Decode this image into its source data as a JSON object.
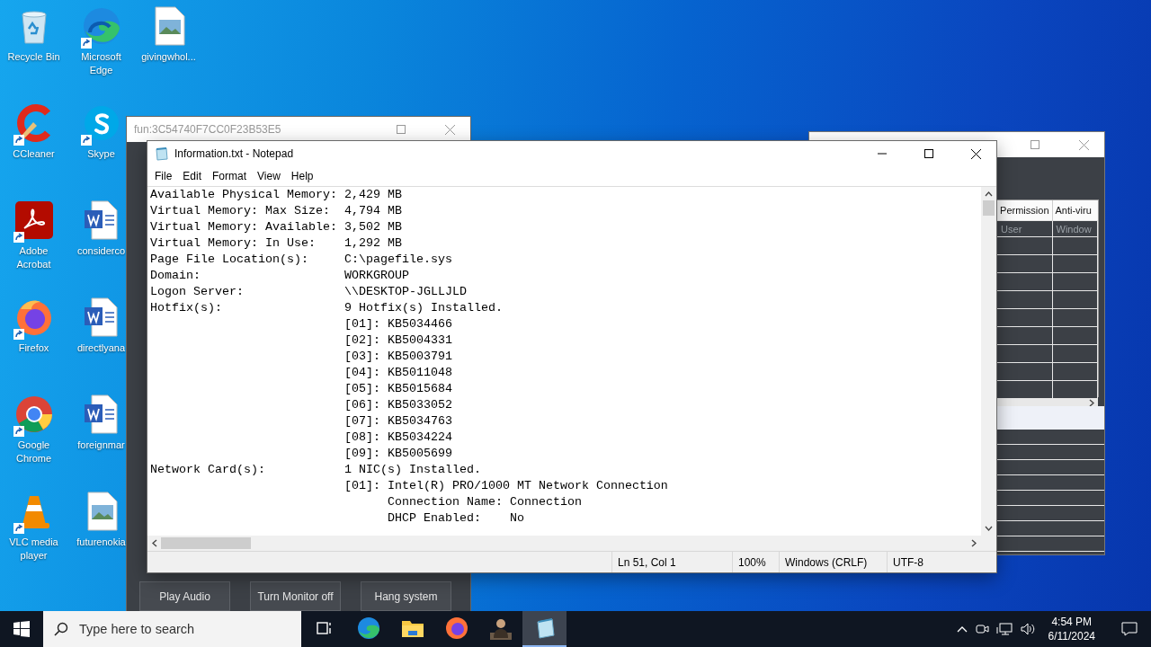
{
  "desktop": {
    "icons": [
      {
        "label": "Recycle Bin",
        "kind": "recycle-bin",
        "shortcut": false
      },
      {
        "label": "CCleaner",
        "kind": "ccleaner",
        "shortcut": true
      },
      {
        "label": "Adobe Acrobat",
        "kind": "acrobat",
        "shortcut": true
      },
      {
        "label": "Firefox",
        "kind": "firefox",
        "shortcut": true
      },
      {
        "label": "Google Chrome",
        "kind": "chrome",
        "shortcut": true
      },
      {
        "label": "VLC media player",
        "kind": "vlc",
        "shortcut": true
      },
      {
        "label": "Microsoft Edge",
        "kind": "edge",
        "shortcut": true
      },
      {
        "label": "Skype",
        "kind": "skype",
        "shortcut": true
      },
      {
        "label": "considerco",
        "kind": "word",
        "shortcut": false
      },
      {
        "label": "directlyana",
        "kind": "word",
        "shortcut": false
      },
      {
        "label": "foreignmar",
        "kind": "word",
        "shortcut": false
      },
      {
        "label": "futurenokia",
        "kind": "image-file",
        "shortcut": false
      },
      {
        "label": "givingwhol...",
        "kind": "image-file",
        "shortcut": false
      }
    ]
  },
  "app_window": {
    "title": "fun:3C54740F7CC0F23B53E5",
    "buttons": [
      "Play Audio",
      "Turn Monitor off",
      "Hang system"
    ]
  },
  "table_window": {
    "columns": [
      "Permission",
      "Anti-viru"
    ],
    "rows": [
      [
        "User",
        "Window"
      ]
    ]
  },
  "notepad": {
    "title": "Information.txt - Notepad",
    "menu": [
      "File",
      "Edit",
      "Format",
      "View",
      "Help"
    ],
    "lines": [
      "Available Physical Memory: 2,429 MB",
      "Virtual Memory: Max Size:  4,794 MB",
      "Virtual Memory: Available: 3,502 MB",
      "Virtual Memory: In Use:    1,292 MB",
      "Page File Location(s):     C:\\pagefile.sys",
      "Domain:                    WORKGROUP",
      "Logon Server:              \\\\DESKTOP-JGLLJLD",
      "Hotfix(s):                 9 Hotfix(s) Installed.",
      "                           [01]: KB5034466",
      "                           [02]: KB5004331",
      "                           [03]: KB5003791",
      "                           [04]: KB5011048",
      "                           [05]: KB5015684",
      "                           [06]: KB5033052",
      "                           [07]: KB5034763",
      "                           [08]: KB5034224",
      "                           [09]: KB5005699",
      "Network Card(s):           1 NIC(s) Installed.",
      "                           [01]: Intel(R) PRO/1000 MT Network Connection",
      "                                 Connection Name: Connection",
      "                                 DHCP Enabled:    No"
    ],
    "status": [
      "Ln 51, Col 1",
      "100%",
      "Windows (CRLF)",
      "UTF-8"
    ]
  },
  "taskbar": {
    "search_placeholder": "Type here to search",
    "apps": [
      {
        "kind": "task-view",
        "active": false
      },
      {
        "kind": "edge",
        "active": false
      },
      {
        "kind": "folder",
        "active": false
      },
      {
        "kind": "firefox",
        "active": false
      },
      {
        "kind": "figure",
        "active": false
      },
      {
        "kind": "notepad",
        "active": true
      }
    ],
    "time": "4:54 PM",
    "date": "6/11/2024"
  }
}
